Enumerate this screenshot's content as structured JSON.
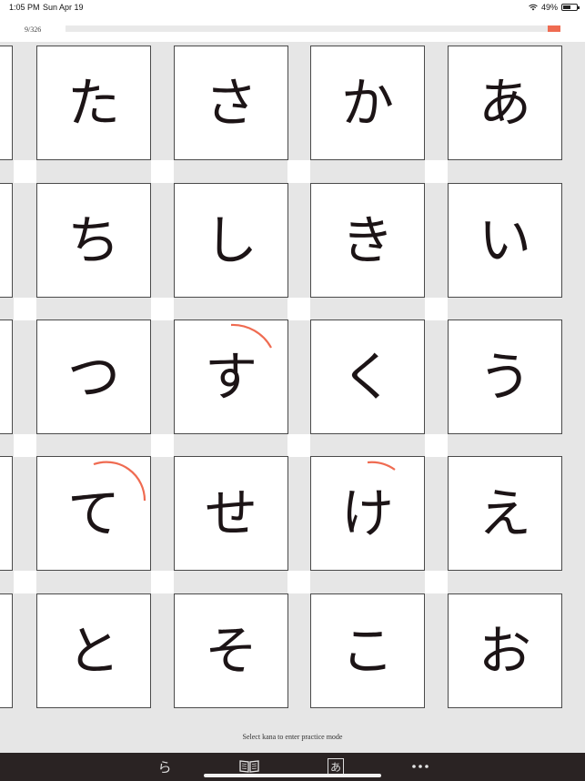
{
  "status_bar": {
    "time": "1:05 PM",
    "date": "Sun Apr 19",
    "battery": "49%",
    "battery_level": 0.49
  },
  "progress": {
    "counter": "9/326"
  },
  "colors": {
    "accent": "#ef6b51",
    "toolbar_bg": "#2a2323",
    "ink": "#1c1416"
  },
  "grid": {
    "columns": [
      [
        "た",
        "ち",
        "つ",
        "て",
        "と"
      ],
      [
        "さ",
        "し",
        "す",
        "せ",
        "そ"
      ],
      [
        "か",
        "き",
        "く",
        "け",
        "こ"
      ],
      [
        "あ",
        "い",
        "う",
        "え",
        "お"
      ]
    ]
  },
  "hint": "Select kana to enter practice mode",
  "toolbar": {
    "item1_glyph": "ら",
    "item2_icon": "book-icon",
    "item3_glyph": "あ",
    "item4_icon": "more-icon"
  }
}
